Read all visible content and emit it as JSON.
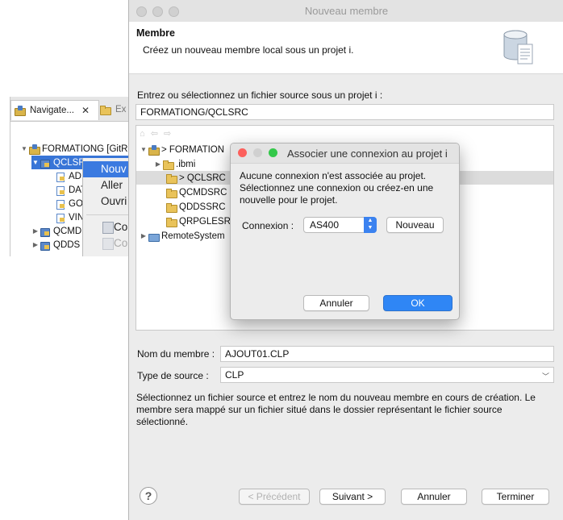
{
  "navigator": {
    "tab_label": "Navigate...",
    "tab2_label": "Ex",
    "close_glyph": "✕",
    "tree": [
      {
        "label": "FORMATIONG [GitR",
        "depth": 0,
        "icon": "project-icon"
      },
      {
        "label": "QCLSR",
        "depth": 1,
        "icon": "library-icon",
        "selected": true
      },
      {
        "label": "AD",
        "depth": 2,
        "icon": "member-icon"
      },
      {
        "label": "DAT",
        "depth": 2,
        "icon": "member-icon"
      },
      {
        "label": "GO",
        "depth": 2,
        "icon": "member-icon"
      },
      {
        "label": "VIN",
        "depth": 2,
        "icon": "member-icon"
      },
      {
        "label": "QCMD",
        "depth": 1,
        "icon": "library-icon"
      },
      {
        "label": "QDDS",
        "depth": 1,
        "icon": "library-icon"
      }
    ]
  },
  "context_menu": {
    "items": [
      "Nouv",
      "Aller",
      "Ouvri",
      "Co",
      "Co"
    ]
  },
  "wizard": {
    "title": "Nouveau membre",
    "header_title": "Membre",
    "header_subtitle": "Créez un nouveau membre local sous un projet i.",
    "source_label": "Entrez ou sélectionnez un fichier source sous un projet i :",
    "source_value": "FORMATIONG/QCLSRC",
    "tree": [
      {
        "label": "> FORMATION",
        "depth": 0,
        "icon": "project-icon"
      },
      {
        "label": ".ibmi",
        "depth": 1,
        "icon": "folder-icon"
      },
      {
        "label": "> QCLSRC",
        "depth": 1,
        "icon": "folder-icon",
        "selected": true
      },
      {
        "label": "QCMDSRC",
        "depth": 1,
        "icon": "folder-icon"
      },
      {
        "label": "QDDSSRC",
        "depth": 1,
        "icon": "folder-icon"
      },
      {
        "label": "QRPGLESR",
        "depth": 1,
        "icon": "folder-icon"
      },
      {
        "label": "RemoteSystem",
        "depth": 0,
        "icon": "remote-icon"
      }
    ],
    "member_name_label": "Nom du membre :",
    "member_name_value": "AJOUT01.CLP",
    "source_type_label": "Type de source :",
    "source_type_value": "CLP",
    "description": "Sélectionnez un fichier source et entrez le nom du nouveau membre en cours de création. Le membre sera mappé sur un fichier situé dans le dossier représentant le fichier source sélectionné.",
    "buttons": {
      "help": "?",
      "previous": "< Précédent",
      "next": "Suivant >",
      "cancel": "Annuler",
      "finish": "Terminer"
    }
  },
  "dialog": {
    "title": "Associer une connexion au projet i",
    "message": "Aucune connexion n'est associée au projet. Sélectionnez une connexion ou créez-en une nouvelle pour le projet.",
    "connection_label": "Connexion :",
    "connection_value": "AS400",
    "new_button": "Nouveau",
    "cancel_button": "Annuler",
    "ok_button": "OK",
    "colors": {
      "close": "#fc605c",
      "minimize": "#d0d0d0",
      "zoom": "#34c84a",
      "accent": "#2f86f5"
    }
  }
}
